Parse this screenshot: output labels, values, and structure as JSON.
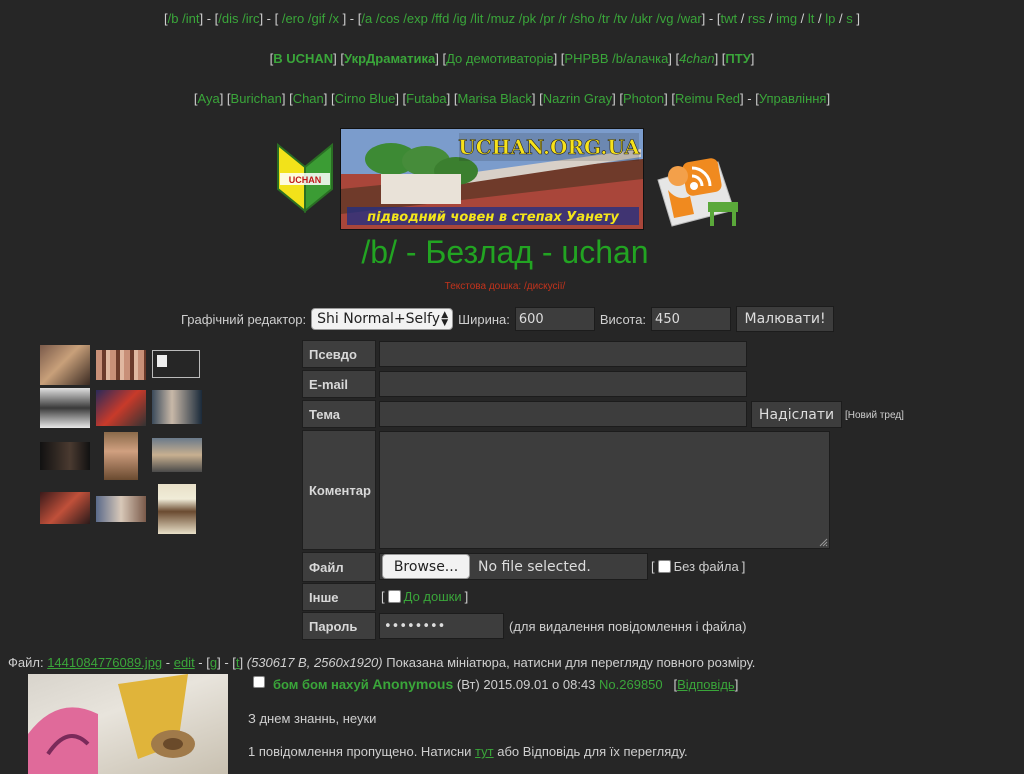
{
  "nav_line1": {
    "g1": [
      "/b",
      "/int"
    ],
    "g2": [
      "/dis",
      "/irc"
    ],
    "g3": [
      "/ero",
      "/gif",
      "/x"
    ],
    "g4": [
      "/a",
      "/cos",
      "/exp",
      "/ffd",
      "/ig",
      "/lit",
      "/muz",
      "/pk",
      "/pr",
      "/r",
      "/sho",
      "/tr",
      "/tv",
      "/ukr",
      "/vg",
      "/war"
    ],
    "g5": [
      "twt",
      "rss",
      "img",
      "lt",
      "lp",
      "s"
    ]
  },
  "nav_line2": [
    "B UCHAN",
    "УкрДраматика",
    "До демотиваторів",
    "PHPBB /b/алачка",
    "4chan",
    "ПТУ"
  ],
  "nav_line3": [
    "Aya",
    "Burichan",
    "Chan",
    "Cirno Blue",
    "Futaba",
    "Marisa Black",
    "Nazrin Gray",
    "Photon",
    "Reimu Red",
    "Управління"
  ],
  "banner": {
    "left_logo": "UCHAN",
    "main_title": "UCHAN.ORG.UA",
    "main_caption": "підводний човен в степах Уанету"
  },
  "board": {
    "title": "/b/ - Безлад - uchan",
    "sub_prefix": "Текстова дошка: ",
    "sub_link": "/дискусії/"
  },
  "draw": {
    "label": "Графічний редактор:",
    "editor": "Shi Normal+Selfy",
    "width_label": "Ширина:",
    "width_value": "600",
    "height_label": "Висота:",
    "height_value": "450",
    "button": "Малювати!"
  },
  "form": {
    "name_label": "Псевдо",
    "email_label": "E-mail",
    "subject_label": "Тема",
    "submit": "Надіслати",
    "new_thread": "[Новий тред]",
    "comment_label": "Коментар",
    "file_label": "Файл",
    "browse": "Browse...",
    "no_file": "No file selected.",
    "no_file_check": "Без файла",
    "other_label": "Інше",
    "to_board": "До дошки",
    "password_label": "Пароль",
    "password_value": "••••••••",
    "password_note": "(для видалення повідомлення і файла)"
  },
  "post": {
    "file_prefix": "Файл:",
    "file_name": "1441084776089.jpg",
    "edit": "edit",
    "g": "g",
    "t": "t",
    "file_info": "(530617 B, 2560x1920)",
    "file_note": "Показана мініатюра, натисни для перегляду повного розміру.",
    "subject": "бом бом нахуй",
    "author": "Anonymous",
    "date": "(Вт) 2015.09.01 о 08:43",
    "number": "No.269850",
    "reply": "Відповідь",
    "body": "З днем знаннь, неуки",
    "omitted_a": "1 повідомлення пропущено. Натисни ",
    "omitted_link": "тут",
    "omitted_b": " або Відповідь для їх перегляду."
  }
}
